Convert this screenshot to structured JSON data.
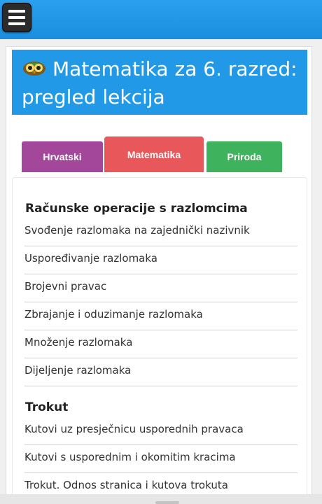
{
  "title": "Matematika za 6. razred: pregled lekcija",
  "tabs": [
    {
      "label": "Hrvatski",
      "color": "#a3479b"
    },
    {
      "label": "Matematika",
      "color": "#e8585a"
    },
    {
      "label": "Priroda",
      "color": "#3fb25e"
    }
  ],
  "sections": [
    {
      "title": "Računske operacije s razlomcima",
      "items": [
        "Svođenje razlomaka na zajednički nazivnik",
        "Uspoređivanje razlomaka",
        "Brojevni pravac",
        "Zbrajanje i oduzimanje razlomaka",
        "Množenje razlomaka",
        "Dijeljenje razlomaka"
      ]
    },
    {
      "title": "Trokut",
      "items": [
        "Kutovi uz presječnicu usporednih pravaca",
        "Kutovi s usporednim i okomitim kracima",
        "Trokut. Odnos stranica i kutova trokuta"
      ]
    }
  ],
  "colors": {
    "header": "#1e90e0",
    "title_bg": "#2299e6"
  },
  "icons": {
    "menu": "hamburger-menu-icon",
    "logo": "owl-icon"
  }
}
